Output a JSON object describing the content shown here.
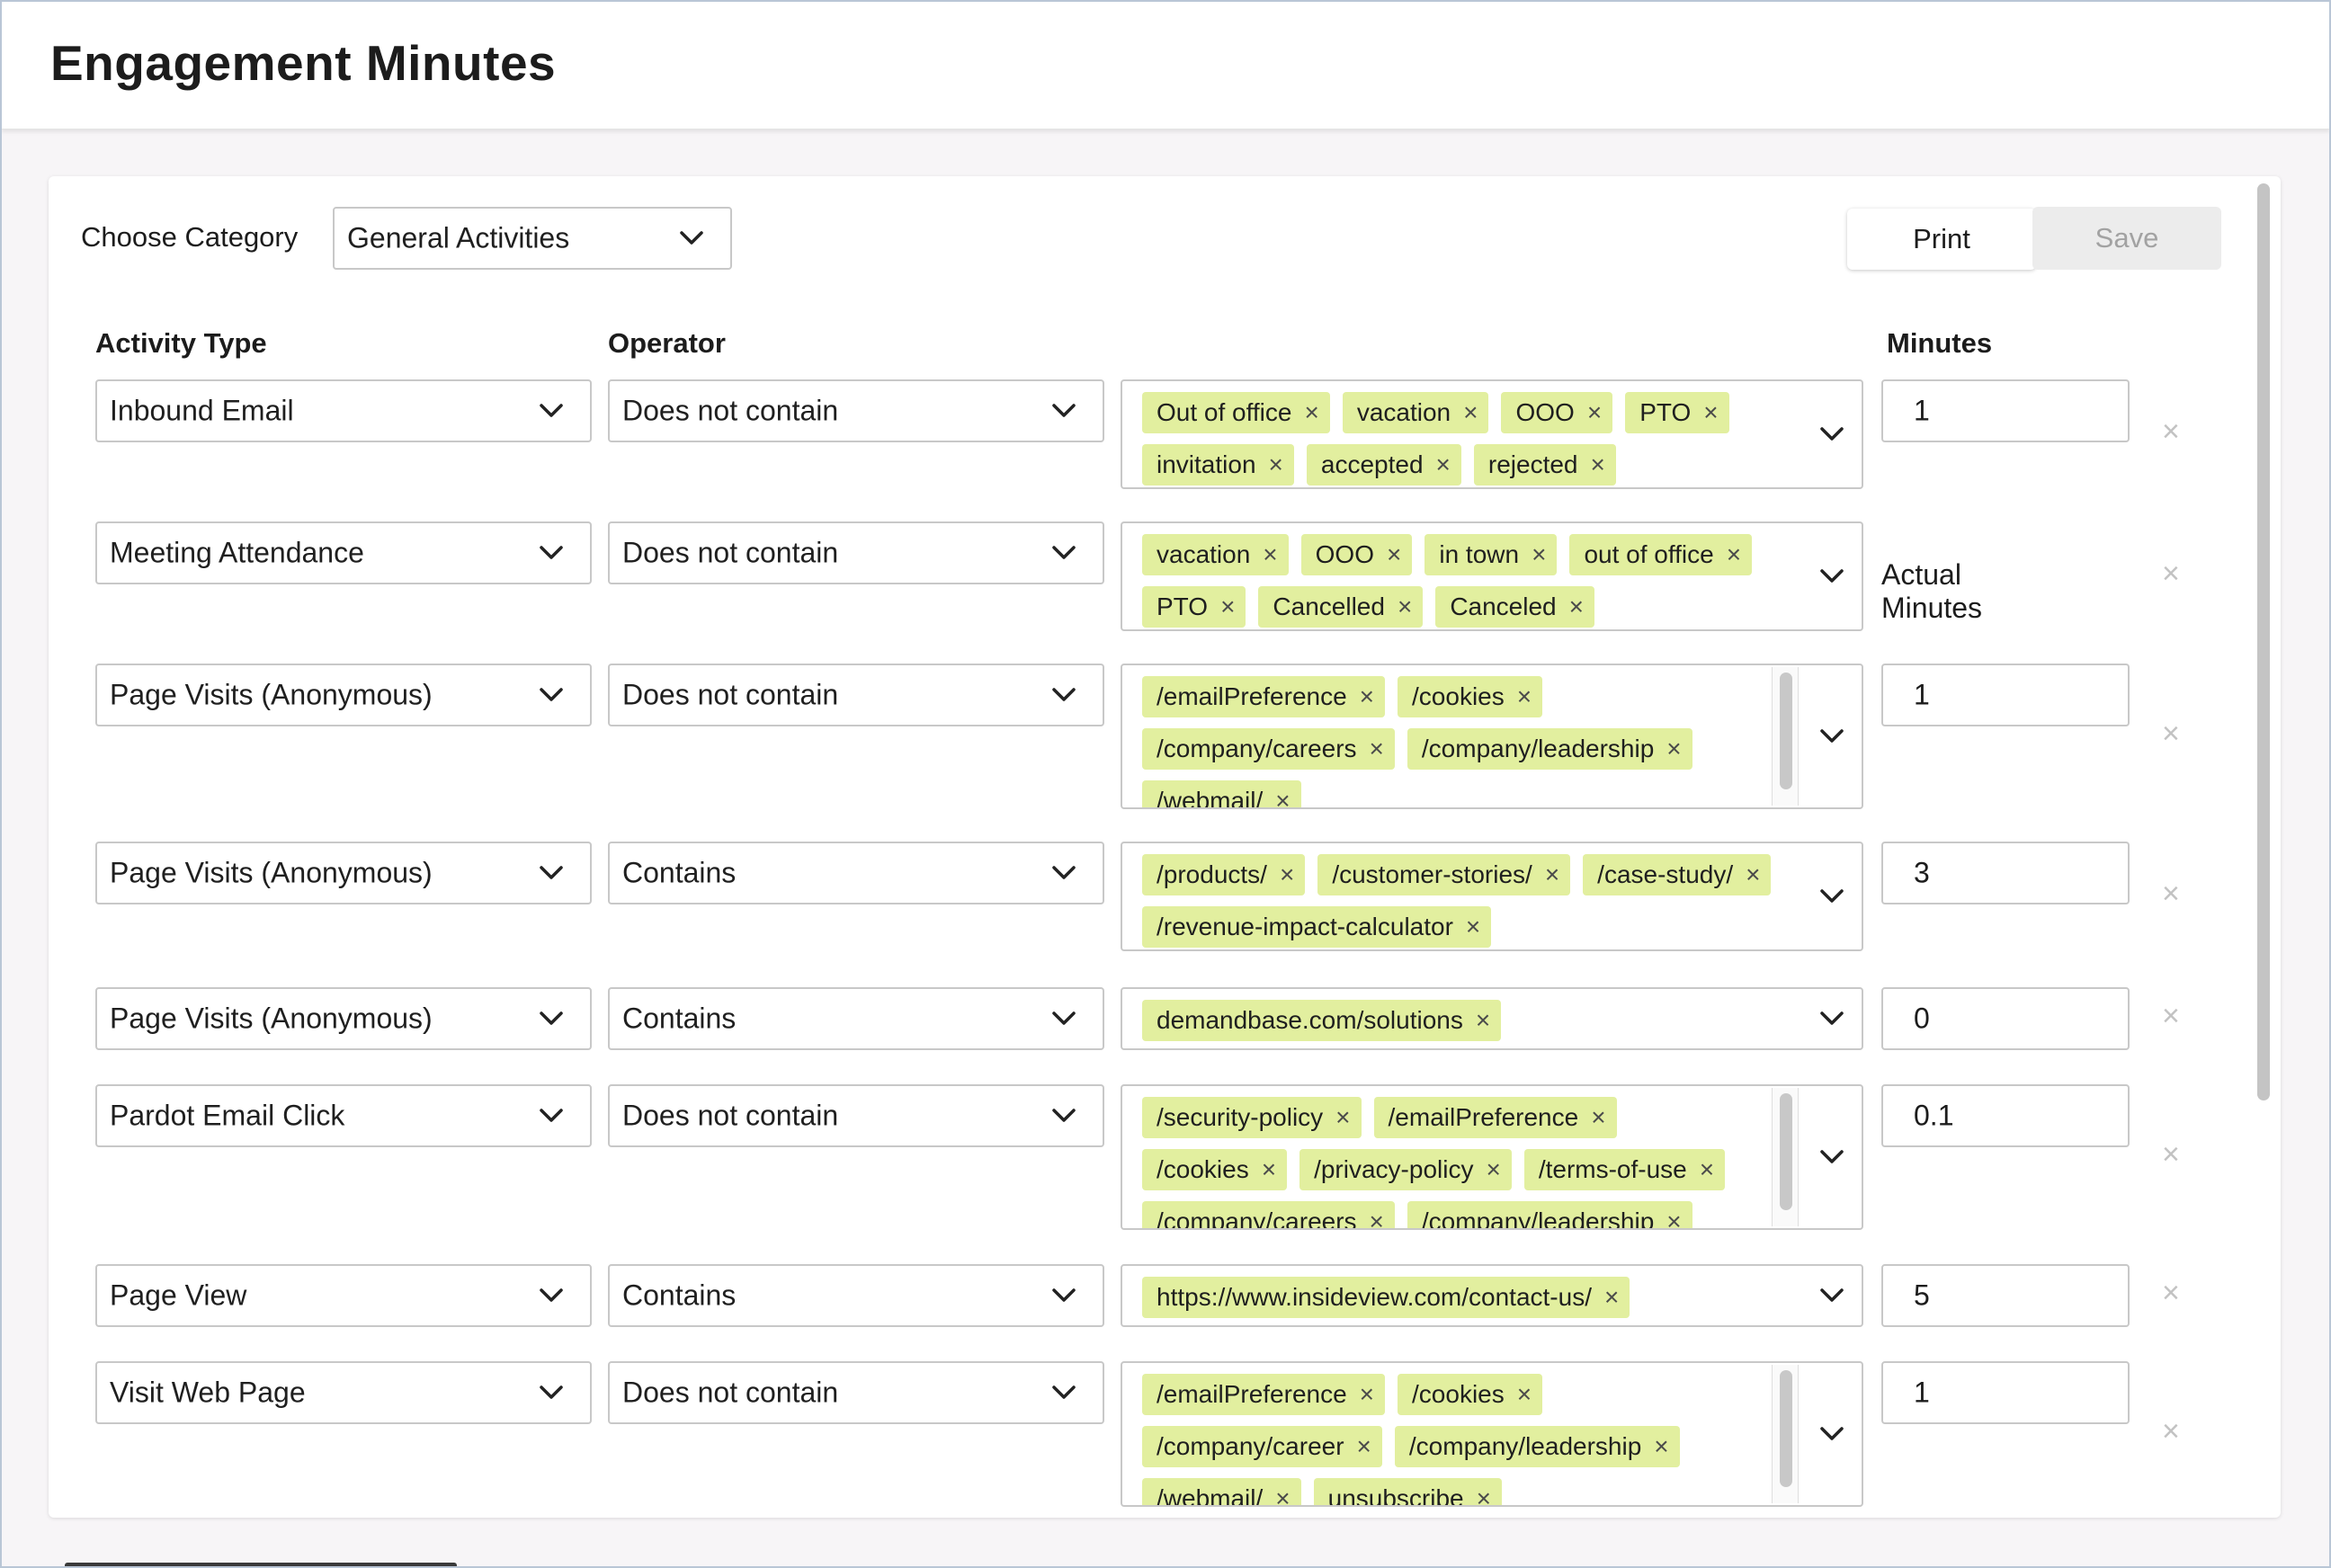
{
  "page": {
    "title": "Engagement Minutes"
  },
  "toolbar": {
    "category_label": "Choose Category",
    "category_value": "General Activities",
    "print_label": "Print",
    "save_label": "Save"
  },
  "columns": {
    "activity_type": "Activity Type",
    "operator": "Operator",
    "minutes": "Minutes"
  },
  "rows": [
    {
      "activity": "Inbound Email",
      "operator": "Does not contain",
      "tags": [
        "Out of office",
        "vacation",
        "OOO",
        "PTO",
        "invitation",
        "accepted",
        "rejected"
      ],
      "minutes": "1"
    },
    {
      "activity": "Meeting Attendance",
      "operator": "Does not contain",
      "tags": [
        "vacation",
        "OOO",
        "in town",
        "out of office",
        "PTO",
        "Cancelled",
        "Canceled"
      ],
      "minutes": "Actual Minutes"
    },
    {
      "activity": "Page Visits (Anonymous)",
      "operator": "Does not contain",
      "tags": [
        "/emailPreference",
        "/cookies",
        "/company/careers",
        "/company/leadership",
        "/webmail/"
      ],
      "minutes": "1"
    },
    {
      "activity": "Page Visits (Anonymous)",
      "operator": "Contains",
      "tags": [
        "/products/",
        "/customer-stories/",
        "/case-study/",
        "/revenue-impact-calculator"
      ],
      "minutes": "3"
    },
    {
      "activity": "Page Visits (Anonymous)",
      "operator": "Contains",
      "tags": [
        "demandbase.com/solutions"
      ],
      "minutes": "0"
    },
    {
      "activity": "Pardot Email Click",
      "operator": "Does not contain",
      "tags": [
        "/security-policy",
        "/emailPreference",
        "/cookies",
        "/privacy-policy",
        "/terms-of-use",
        "/company/careers",
        "/company/leadership"
      ],
      "minutes": "0.1"
    },
    {
      "activity": "Page View",
      "operator": "Contains",
      "tags": [
        "https://www.insideview.com/contact-us/"
      ],
      "minutes": "5"
    },
    {
      "activity": "Visit Web Page",
      "operator": "Does not contain",
      "tags": [
        "/emailPreference",
        "/cookies",
        "/company/career",
        "/company/leadership",
        "/webmail/",
        "unsubscribe"
      ],
      "minutes": "1"
    }
  ],
  "icons": {
    "tag_remove": "×",
    "row_remove": "×"
  },
  "colors": {
    "tag_background": "#e2ef9f",
    "save_disabled": "#ececec"
  }
}
